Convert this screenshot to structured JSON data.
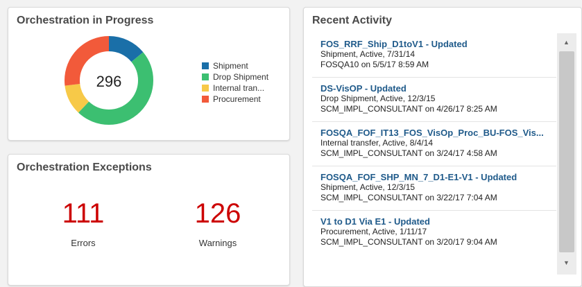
{
  "progress": {
    "title": "Orchestration in Progress",
    "total": "296",
    "segments": [
      {
        "name": "Shipment",
        "color": "#1a6fa8",
        "fraction": 0.14
      },
      {
        "name": "Drop Shipment",
        "color": "#3cbf71",
        "fraction": 0.48
      },
      {
        "name": "Internal tran...",
        "color": "#f7c948",
        "fraction": 0.11
      },
      {
        "name": "Procurement",
        "color": "#f25a3a",
        "fraction": 0.27
      }
    ]
  },
  "exceptions": {
    "title": "Orchestration Exceptions",
    "errors": {
      "value": "111",
      "label": "Errors"
    },
    "warnings": {
      "value": "126",
      "label": "Warnings"
    }
  },
  "activity": {
    "title": "Recent Activity",
    "items": [
      {
        "title": "FOS_RRF_Ship_D1toV1 - Updated",
        "line1": "Shipment, Active, 7/31/14",
        "line2": "FOSQA10 on 5/5/17 8:59 AM"
      },
      {
        "title": "DS-VisOP - Updated",
        "line1": "Drop Shipment, Active, 12/3/15",
        "line2": "SCM_IMPL_CONSULTANT on 4/26/17 8:25 AM"
      },
      {
        "title": "FOSQA_FOF_IT13_FOS_VisOp_Proc_BU-FOS_Vis...",
        "line1": "Internal transfer, Active, 8/4/14",
        "line2": "SCM_IMPL_CONSULTANT on 3/24/17 4:58 AM"
      },
      {
        "title": "FOSQA_FOF_SHP_MN_7_D1-E1-V1 - Updated",
        "line1": "Shipment, Active, 12/3/15",
        "line2": "SCM_IMPL_CONSULTANT on 3/22/17 7:04 AM"
      },
      {
        "title": "V1 to D1 Via E1 - Updated",
        "line1": "Procurement, Active, 1/11/17",
        "line2": "SCM_IMPL_CONSULTANT on 3/20/17 9:04 AM"
      }
    ]
  },
  "icons": {
    "scroll_up": "▲",
    "scroll_down": "▼"
  }
}
